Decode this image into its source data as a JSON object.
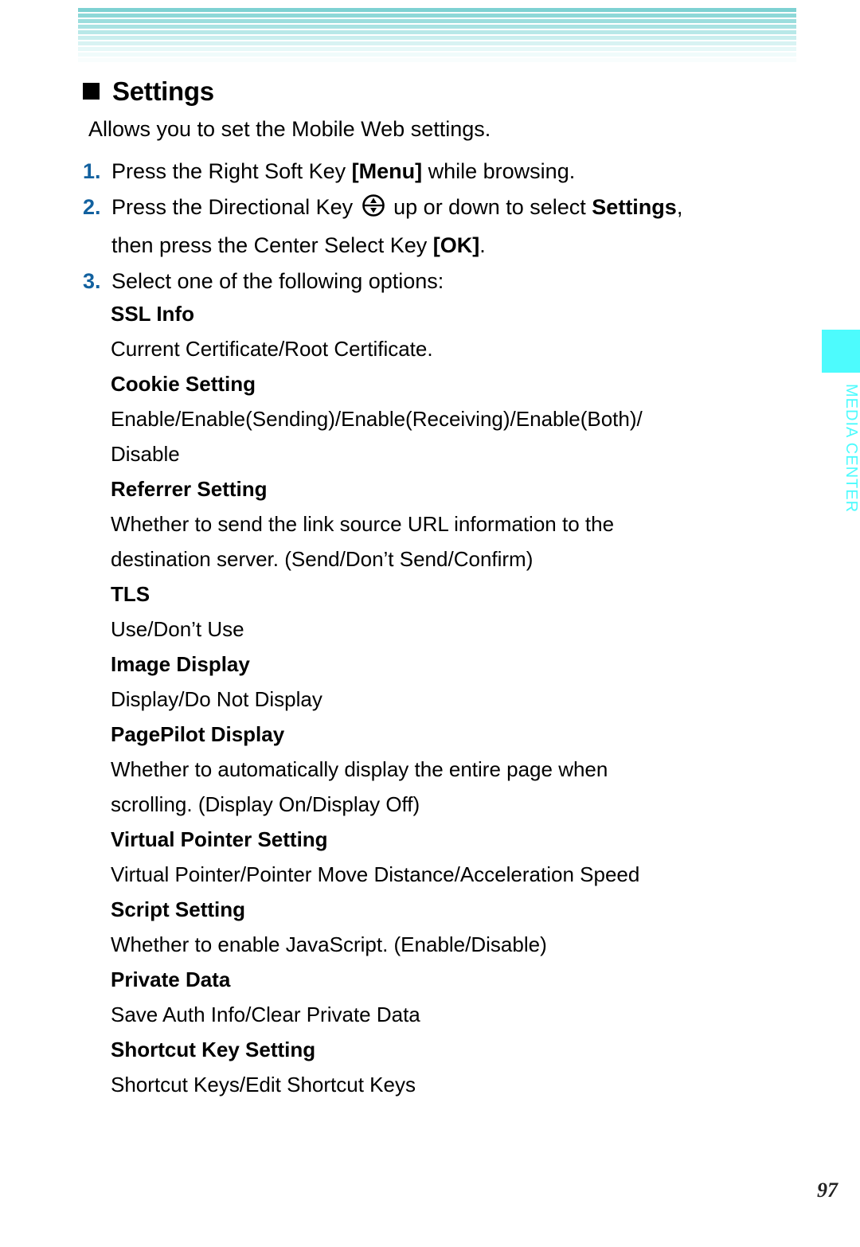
{
  "header": {
    "stripe_colors": [
      "#7ed1d2",
      "#8ed8d8",
      "#9bdddd",
      "#a8e2e2",
      "#b8e8e8",
      "#c9eeee",
      "#d8f3f3",
      "#e6f8f8",
      "#f0fbfb",
      "#f8fdfd"
    ]
  },
  "section": {
    "bullet_icon": "black-square-bullet-icon",
    "title": "Settings",
    "intro": "Allows you to set the Mobile Web settings."
  },
  "steps": [
    {
      "number": "1.",
      "parts": [
        {
          "text": "Press the Right Soft Key ",
          "style": "normal"
        },
        {
          "text": "[Menu]",
          "style": "bold"
        },
        {
          "text": " while browsing.",
          "style": "normal"
        }
      ]
    },
    {
      "number": "2.",
      "parts": [
        {
          "text": "Press the Directional Key ",
          "style": "normal"
        },
        {
          "text": "",
          "style": "icon",
          "icon": "directional-key-up-down-icon"
        },
        {
          "text": " up or down to select ",
          "style": "normal"
        },
        {
          "text": "Settings",
          "style": "bold"
        },
        {
          "text": ",",
          "style": "normal"
        },
        {
          "text": "then press the Center Select Key ",
          "style": "normal-wrap"
        },
        {
          "text": "[OK]",
          "style": "bold"
        },
        {
          "text": ".",
          "style": "normal"
        }
      ]
    },
    {
      "number": "3.",
      "parts": [
        {
          "text": "Select one of the following options:",
          "style": "normal"
        }
      ]
    }
  ],
  "step_lines": {
    "step1": "Press the Right Soft Key [Menu] while browsing.",
    "step2_line1_a": "Press the Directional Key ",
    "step2_line1_b": " up or down to select ",
    "step2_line1_bold": "Settings",
    "step2_line1_tail": ",",
    "step2_line2_a": "then press the Center Select Key ",
    "step2_line2_bold": "[OK]",
    "step2_line2_tail": ".",
    "step3": "Select one of the following options:",
    "step1_a": "Press the Right Soft Key ",
    "step1_bold": "[Menu]",
    "step1_tail": " while browsing."
  },
  "options": [
    {
      "term": "SSL Info",
      "desc_lines": [
        "Current Certificate/Root Certificate."
      ]
    },
    {
      "term": "Cookie Setting",
      "desc_lines": [
        "Enable/Enable(Sending)/Enable(Receiving)/Enable(Both)/",
        "Disable"
      ]
    },
    {
      "term": "Referrer Setting",
      "desc_lines": [
        "Whether to send the link source URL information to the",
        "destination server. (Send/Don’t Send/Confirm)"
      ]
    },
    {
      "term": "TLS",
      "desc_lines": [
        "Use/Don’t Use"
      ]
    },
    {
      "term": "Image Display",
      "desc_lines": [
        "Display/Do Not Display"
      ]
    },
    {
      "term": "PagePilot Display",
      "desc_lines": [
        "Whether to automatically display the entire page when",
        "scrolling. (Display On/Display Off)"
      ]
    },
    {
      "term": "Virtual Pointer Setting",
      "desc_lines": [
        "Virtual Pointer/Pointer Move Distance/Acceleration Speed"
      ]
    },
    {
      "term": "Script Setting",
      "desc_lines": [
        "Whether to enable JavaScript. (Enable/Disable)"
      ]
    },
    {
      "term": "Private Data",
      "desc_lines": [
        "Save Auth Info/Clear Private Data"
      ]
    },
    {
      "term": "Shortcut Key Setting",
      "desc_lines": [
        "Shortcut Keys/Edit Shortcut Keys"
      ]
    }
  ],
  "side_tab": {
    "label": "MEDIA CENTER",
    "color": "#4DFBFD"
  },
  "footer": {
    "page_number": "97"
  },
  "colors": {
    "step_number_blue": "#12619F",
    "tab_cyan": "#4DFBFD",
    "text_black": "#000000"
  }
}
